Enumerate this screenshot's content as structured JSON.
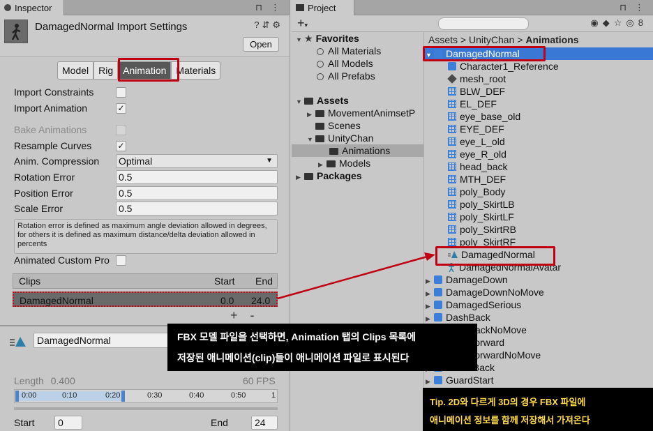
{
  "inspector": {
    "tab_title": "Inspector",
    "title": "DamagedNormal Import Settings",
    "open_label": "Open",
    "tabs": [
      "Model",
      "Rig",
      "Animation",
      "Materials"
    ],
    "active_tab": "Animation",
    "import_constraints_label": "Import Constraints",
    "import_constraints_checked": false,
    "import_animation_label": "Import Animation",
    "import_animation_checked": true,
    "bake_animations_label": "Bake Animations",
    "resample_curves_label": "Resample Curves",
    "resample_curves_checked": true,
    "anim_compression_label": "Anim. Compression",
    "anim_compression_value": "Optimal",
    "rotation_error_label": "Rotation Error",
    "rotation_error_value": "0.5",
    "position_error_label": "Position Error",
    "position_error_value": "0.5",
    "scale_error_label": "Scale Error",
    "scale_error_value": "0.5",
    "help_text": "Rotation error is defined as maximum angle deviation allowed in degrees, for others it is defined as maximum distance/delta deviation allowed in percents",
    "animated_custom_props_label": "Animated Custom Pro",
    "clips": {
      "header_clips": "Clips",
      "header_start": "Start",
      "header_end": "End",
      "rows": [
        {
          "name": "DamagedNormal",
          "start": "0.0",
          "end": "24.0"
        }
      ],
      "add_label": "+",
      "remove_label": "-"
    },
    "clip_name_value": "DamagedNormal",
    "length_label": "Length",
    "length_value": "0.400",
    "fps_label": "60 FPS",
    "timeline_ticks": [
      "0:00",
      "0:10",
      "0:20",
      "0:30",
      "0:40",
      "0:50",
      "1"
    ],
    "start_label": "Start",
    "start_value": "0",
    "end_label": "End",
    "end_value": "24"
  },
  "project": {
    "tab_title": "Project",
    "plus_label": "+",
    "hidden_count": "8",
    "favorites_label": "Favorites",
    "favorites": [
      "All Materials",
      "All Models",
      "All Prefabs"
    ],
    "assets_label": "Assets",
    "assets_children": [
      "MovementAnimsetP",
      "Scenes",
      "UnityChan"
    ],
    "unitychan_children": [
      "Animations",
      "Models"
    ],
    "packages_label": "Packages",
    "breadcrumb": [
      "Assets",
      "UnityChan",
      "Animations"
    ],
    "files": [
      {
        "name": "DamagedNormal",
        "kind": "model",
        "expanded": true,
        "selected": true
      },
      {
        "name": "Character1_Reference",
        "kind": "model-child"
      },
      {
        "name": "mesh_root",
        "kind": "object"
      },
      {
        "name": "BLW_DEF",
        "kind": "mesh"
      },
      {
        "name": "EL_DEF",
        "kind": "mesh"
      },
      {
        "name": "eye_base_old",
        "kind": "mesh"
      },
      {
        "name": "EYE_DEF",
        "kind": "mesh"
      },
      {
        "name": "eye_L_old",
        "kind": "mesh"
      },
      {
        "name": "eye_R_old",
        "kind": "mesh"
      },
      {
        "name": "head_back",
        "kind": "mesh"
      },
      {
        "name": "MTH_DEF",
        "kind": "mesh"
      },
      {
        "name": "poly_Body",
        "kind": "mesh"
      },
      {
        "name": "poly_SkirtLB",
        "kind": "mesh"
      },
      {
        "name": "poly_SkirtLF",
        "kind": "mesh"
      },
      {
        "name": "poly_SkirtRB",
        "kind": "mesh"
      },
      {
        "name": "poly_SkirtRF",
        "kind": "mesh"
      },
      {
        "name": "DamagedNormal",
        "kind": "anim-clip"
      },
      {
        "name": "DamagedNormalAvatar",
        "kind": "avatar"
      },
      {
        "name": "DamageDown",
        "kind": "model"
      },
      {
        "name": "DamageDownNoMove",
        "kind": "model"
      },
      {
        "name": "DamagedSerious",
        "kind": "model"
      },
      {
        "name": "DashBack",
        "kind": "model"
      },
      {
        "name": "DashBackNoMove",
        "kind": "model"
      },
      {
        "name": "DashForward",
        "kind": "model"
      },
      {
        "name": "DashForwardNoMove",
        "kind": "model"
      },
      {
        "name": "GuardBack",
        "kind": "model"
      },
      {
        "name": "GuardStart",
        "kind": "model"
      }
    ]
  },
  "callout": {
    "line1": "FBX 모델 파일을 선택하면, Animation 탭의 Clips 목록에",
    "line2": "저장된 애니메이션(clip)들이 애니메이션 파일로 표시된다"
  },
  "tip": {
    "line1": "Tip. 2D와 다르게 3D의 경우 FBX 파일에",
    "line2": "애니메이션 정보를 함께 저장해서 가져온다"
  },
  "colors": {
    "highlight_red": "#c00010",
    "selection_blue": "#3a78d6",
    "callout_bg": "#000000",
    "tip_text": "#ffd84a"
  }
}
